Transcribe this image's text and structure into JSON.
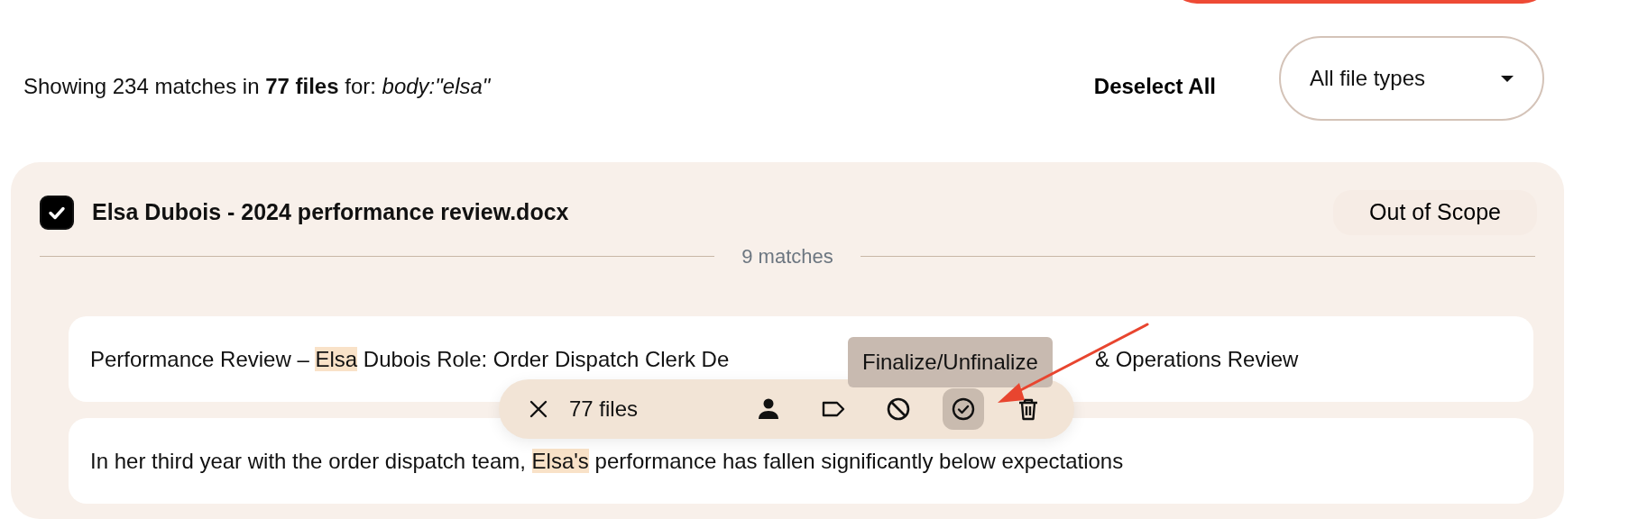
{
  "summary": "Showing 234 matches in **77 files** for: *body:\"elsa\"*",
  "deselect_label": "Deselect All",
  "file_type_filter": {
    "value": "All file types"
  },
  "result": {
    "checked": true,
    "title": "Elsa Dubois - 2024 performance review.docx",
    "status": "Out of Scope",
    "match_count": "9 matches",
    "snippets": [
      {
        "segments": [
          {
            "text": "Performance Review – ",
            "highlight": false
          },
          {
            "text": "Elsa",
            "highlight": true
          },
          {
            "text": " Dubois Role: Order Dispatch Clerk De",
            "highlight": false
          }
        ],
        "trailing_segments": [
          {
            "text": "& Operations Review",
            "highlight": false
          }
        ]
      },
      {
        "segments": [
          {
            "text": "In her third year with the order dispatch team, ",
            "highlight": false
          },
          {
            "text": "Elsa's",
            "highlight": true
          },
          {
            "text": " performance has fallen significantly below expectations",
            "highlight": false
          }
        ]
      }
    ]
  },
  "action_bar": {
    "count": "77 files",
    "actions": [
      {
        "kind": "person",
        "active": false
      },
      {
        "kind": "tag",
        "active": false
      },
      {
        "kind": "ban",
        "active": false
      },
      {
        "kind": "check",
        "active": true
      },
      {
        "kind": "trash",
        "active": false
      }
    ],
    "tooltip": "Finalize/Unfinalize"
  }
}
